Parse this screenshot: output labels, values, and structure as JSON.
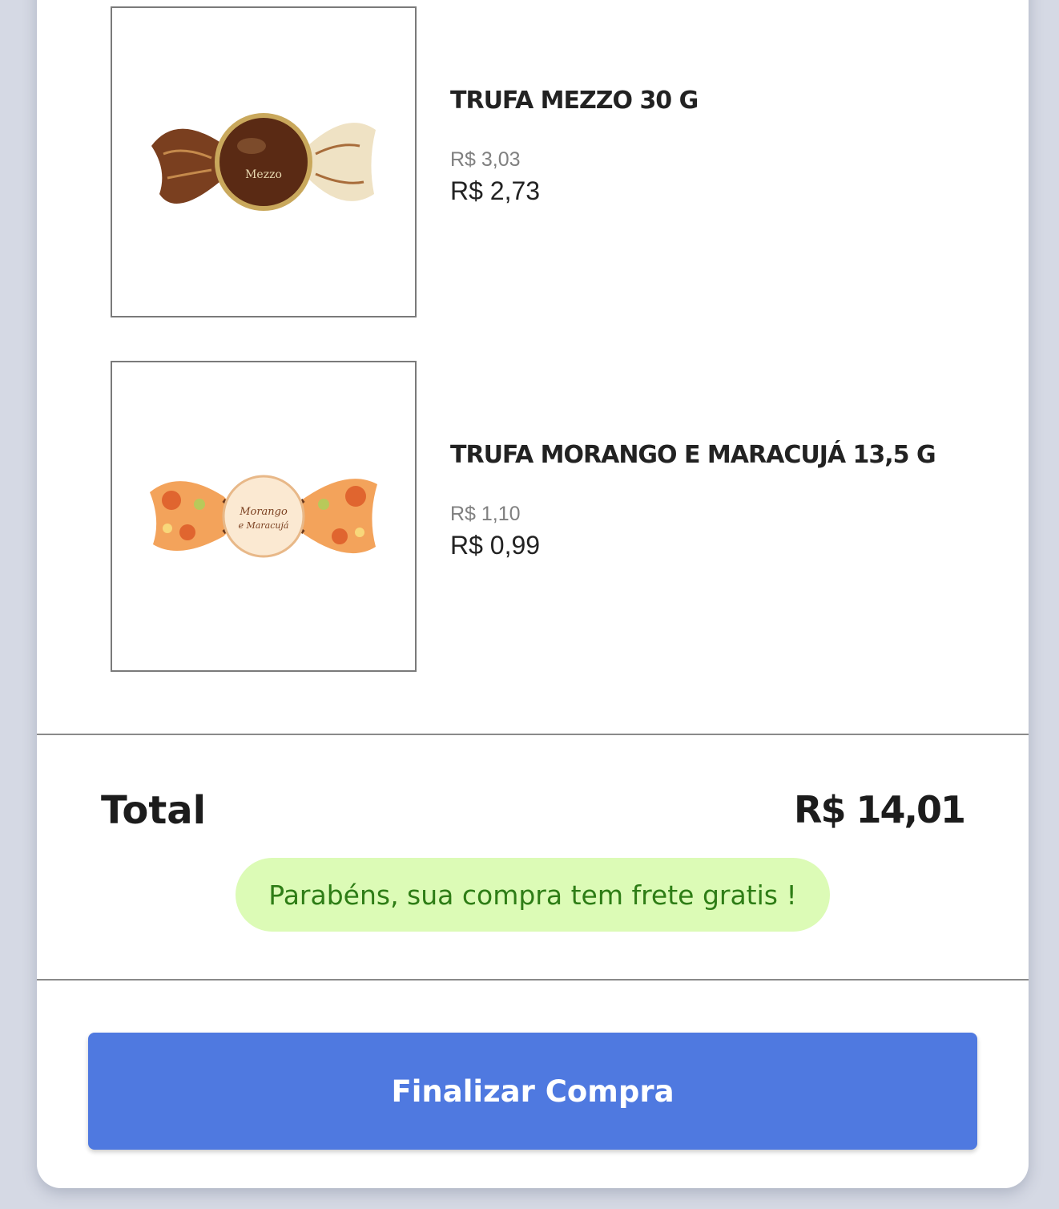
{
  "cart": {
    "items": [
      {
        "name": "TRUFA MEZZO 30 G",
        "old_price": "R$ 3,03",
        "price": "R$ 2,73",
        "image": "truffle-mezzo-wrapper",
        "image_label": "Mezzo"
      },
      {
        "name": "TRUFA MORANGO E MARACUJÁ 13,5 G",
        "old_price": "R$ 1,10",
        "price": "R$ 0,99",
        "image": "truffle-morango-maracuja-wrapper",
        "image_label": "Morango e Maracujá"
      }
    ]
  },
  "summary": {
    "total_label": "Total",
    "total_value": "R$ 14,01",
    "free_shipping_message": "Parabéns, sua compra tem frete gratis !"
  },
  "actions": {
    "checkout_label": "Finalizar Compra"
  },
  "colors": {
    "background": "#d5d9e4",
    "card": "#ffffff",
    "checkout_button": "#4f79e0",
    "free_shipping_bg": "#dcfbb6",
    "free_shipping_text": "#2e7d16",
    "old_price": "#808080"
  }
}
